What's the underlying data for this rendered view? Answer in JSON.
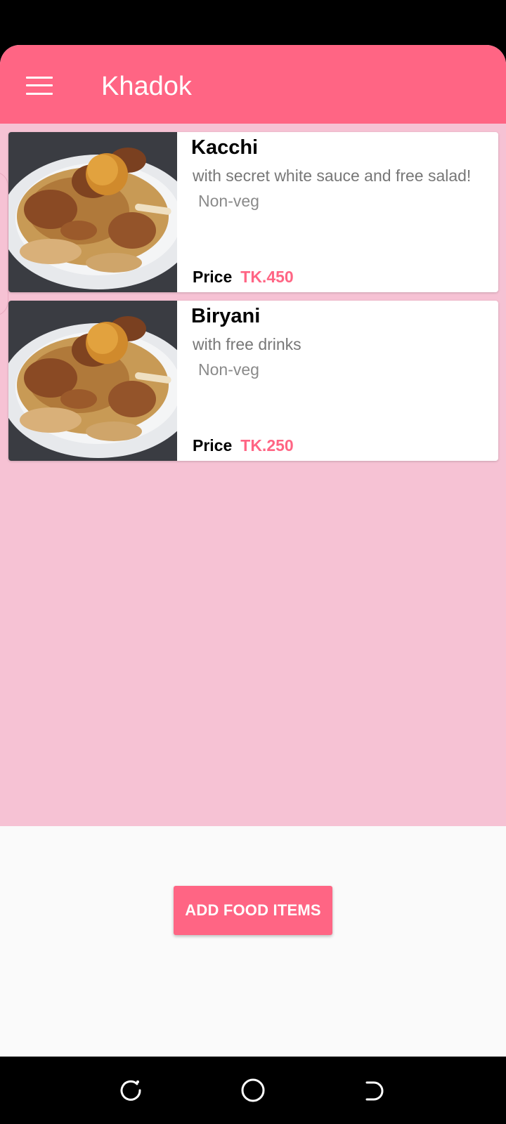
{
  "app": {
    "title": "Khadok"
  },
  "toolbar": {
    "menu_icon": "hamburger-menu-icon",
    "background_color": "#ff6584"
  },
  "food_items": [
    {
      "name": "Kacchi",
      "description": "with secret white sauce and free salad!",
      "type": "Non-veg",
      "price_label": "Price",
      "price": "TK.450"
    },
    {
      "name": "Biryani",
      "description": "with free drinks",
      "type": "Non-veg",
      "price_label": "Price",
      "price": "TK.250"
    }
  ],
  "actions": {
    "add_food_label": "ADD FOOD ITEMS"
  },
  "colors": {
    "accent": "#ff6584",
    "list_background": "#f6c2d4",
    "surface": "#fafafa"
  },
  "navigation_bar": {
    "recents_icon": "recents-icon",
    "home_icon": "home-icon",
    "back_icon": "back-icon"
  }
}
